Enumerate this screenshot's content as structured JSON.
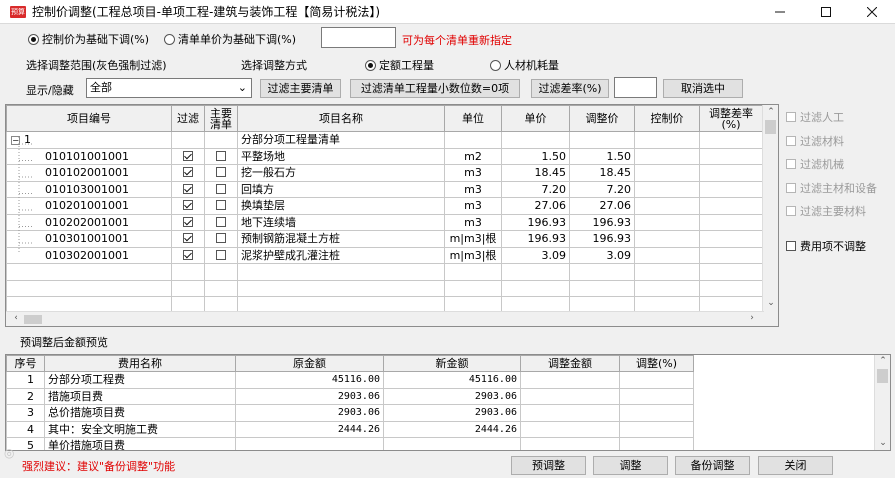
{
  "window": {
    "title": "控制价调整(工程总项目-单项工程-建筑与装饰工程【简易计税法】)",
    "app_badge": "预算",
    "controls": [
      "minimize-icon",
      "maximize-icon",
      "close-icon"
    ]
  },
  "mode": {
    "option_control": "控制价为基础下调(%)",
    "option_unit": "清单单价为基础下调(%)",
    "selected": "option_control",
    "rate_value": "",
    "hint": "可为每个清单重新指定"
  },
  "range": {
    "label": "选择调整范围(灰色强制过滤)",
    "method_label": "选择调整方式",
    "opt_quota": "定额工程量",
    "opt_labor": "人材机耗量",
    "selected": "opt_quota"
  },
  "toolbar": {
    "show_hide_label": "显示/隐藏",
    "show_hide_value": "全部",
    "btn_filter_main": "过滤主要清单",
    "btn_filter_decimal": "过滤清单工程量小数位数=0项",
    "btn_filter_diff": "过滤差率(%)",
    "diff_value": "",
    "btn_cancel_select": "取消选中"
  },
  "items_table": {
    "headers": [
      "项目编号",
      "过滤",
      "主要清单",
      "项目名称",
      "单位",
      "单价",
      "调整价",
      "控制价",
      "调整差率(%)"
    ],
    "group": {
      "code": "1",
      "name": "分部分项工程量清单"
    },
    "rows": [
      {
        "code": "010101001001",
        "filter": true,
        "main": false,
        "name": "平整场地",
        "unit": "m2",
        "price": "1.50",
        "adjusted": "1.50",
        "control": "",
        "rate": ""
      },
      {
        "code": "010102001001",
        "filter": true,
        "main": false,
        "name": "挖一般石方",
        "unit": "m3",
        "price": "18.45",
        "adjusted": "18.45",
        "control": "",
        "rate": ""
      },
      {
        "code": "010103001001",
        "filter": true,
        "main": false,
        "name": "回填方",
        "unit": "m3",
        "price": "7.20",
        "adjusted": "7.20",
        "control": "",
        "rate": ""
      },
      {
        "code": "010201001001",
        "filter": true,
        "main": false,
        "name": "换填垫层",
        "unit": "m3",
        "price": "27.06",
        "adjusted": "27.06",
        "control": "",
        "rate": ""
      },
      {
        "code": "010202001001",
        "filter": true,
        "main": false,
        "name": "地下连续墙",
        "unit": "m3",
        "price": "196.93",
        "adjusted": "196.93",
        "control": "",
        "rate": ""
      },
      {
        "code": "010301001001",
        "filter": true,
        "main": false,
        "name": "预制钢筋混凝土方桩",
        "unit": "m|m3|根",
        "price": "196.93",
        "adjusted": "196.93",
        "control": "",
        "rate": ""
      },
      {
        "code": "010302001001",
        "filter": true,
        "main": false,
        "name": "泥浆护壁成孔灌注桩",
        "unit": "m|m3|根",
        "price": "3.09",
        "adjusted": "3.09",
        "control": "",
        "rate": ""
      }
    ]
  },
  "side_filters": [
    {
      "label": "过滤人工",
      "disabled": true
    },
    {
      "label": "过滤材料",
      "disabled": true
    },
    {
      "label": "过滤机械",
      "disabled": true
    },
    {
      "label": "过滤主材和设备",
      "disabled": true
    },
    {
      "label": "过滤主要材料",
      "disabled": true
    }
  ],
  "fee_no_adjust": "费用项不调整",
  "preview": {
    "label": "预调整后金额预览",
    "headers": [
      "序号",
      "费用名称",
      "原金额",
      "新金额",
      "调整金额",
      "调整(%)"
    ],
    "rows": [
      {
        "no": "1",
        "name": "分部分项工程费",
        "orig": "45116.00",
        "new": "45116.00",
        "adj": "",
        "pct": ""
      },
      {
        "no": "2",
        "name": "措施项目费",
        "orig": "2903.06",
        "new": "2903.06",
        "adj": "",
        "pct": ""
      },
      {
        "no": "3",
        "name": "总价措施项目费",
        "orig": "2903.06",
        "new": "2903.06",
        "adj": "",
        "pct": ""
      },
      {
        "no": "4",
        "name": "其中：安全文明施工费",
        "orig": "2444.26",
        "new": "2444.26",
        "adj": "",
        "pct": ""
      },
      {
        "no": "5",
        "name": "单价措施项目费",
        "orig": "",
        "new": "",
        "adj": "",
        "pct": ""
      }
    ]
  },
  "footer": {
    "tip": "强烈建议：建议\"备份调整\"功能",
    "btn_preview": "预调整",
    "btn_adjust": "调整",
    "btn_backup": "备份调整",
    "btn_close": "关闭"
  },
  "colors": {
    "hint_red": "#e00000",
    "app_badge": "#d92b2b"
  }
}
